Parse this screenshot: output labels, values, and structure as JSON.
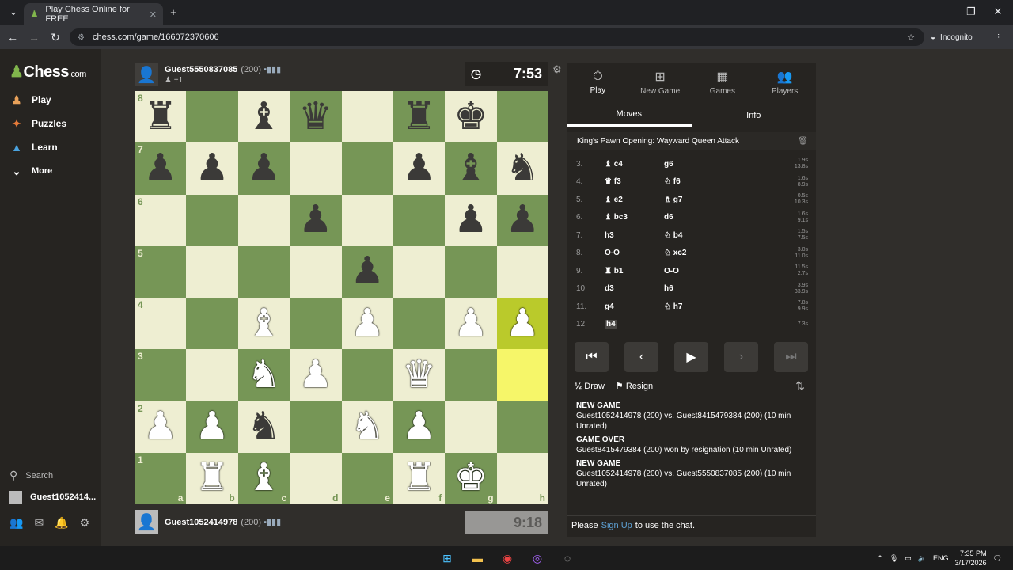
{
  "browser": {
    "tab_title": "Play Chess Online for FREE",
    "url": "chess.com/game/166072370606",
    "incognito_label": "Incognito"
  },
  "sidebar": {
    "logo": "Chess",
    "logo_suffix": ".com",
    "items": [
      {
        "label": "Play",
        "icon": "play-pawn-icon"
      },
      {
        "label": "Puzzles",
        "icon": "puzzle-icon"
      },
      {
        "label": "Learn",
        "icon": "learn-cap-icon"
      },
      {
        "label": "More",
        "icon": "chevron-down-icon"
      }
    ],
    "search_label": "Search",
    "user_label": "Guest1052414..."
  },
  "top_player": {
    "name": "Guest5550837085",
    "rating": "(200)",
    "sub": "+1",
    "clock": "7:53"
  },
  "bottom_player": {
    "name": "Guest1052414978",
    "rating": "(200)",
    "clock": "9:18"
  },
  "board": {
    "ranks": [
      "8",
      "7",
      "6",
      "5",
      "4",
      "3",
      "2",
      "1"
    ],
    "files": [
      "a",
      "b",
      "c",
      "d",
      "e",
      "f",
      "g",
      "h"
    ],
    "position": [
      [
        "br",
        "",
        "bb",
        "bq",
        "",
        "br",
        "bk",
        ""
      ],
      [
        "bp",
        "bp",
        "bp",
        "",
        "",
        "bp",
        "bb",
        "bn"
      ],
      [
        "",
        "",
        "",
        "bp",
        "",
        "",
        "bp",
        "bp"
      ],
      [
        "",
        "",
        "",
        "",
        "bp",
        "",
        "",
        ""
      ],
      [
        "",
        "",
        "wb",
        "",
        "wp",
        "",
        "wp",
        "wp"
      ],
      [
        "",
        "",
        "wn",
        "wp",
        "",
        "wq",
        "",
        ""
      ],
      [
        "wp",
        "wp",
        "bn",
        "",
        "wn",
        "wp",
        "",
        ""
      ],
      [
        "",
        "wr",
        "wb",
        "",
        "",
        "wr",
        "wk",
        ""
      ]
    ],
    "highlight": [
      "h4",
      "h3"
    ]
  },
  "panel": {
    "tabs": [
      {
        "label": "Play",
        "icon": "stopwatch-icon"
      },
      {
        "label": "New Game",
        "icon": "plus-icon"
      },
      {
        "label": "Games",
        "icon": "board-icon"
      },
      {
        "label": "Players",
        "icon": "players-icon"
      }
    ],
    "subtabs": [
      "Moves",
      "Info"
    ],
    "opening": "King's Pawn Opening: Wayward Queen Attack",
    "moves": [
      {
        "no": "3.",
        "w": "♝ c4",
        "b": "g6",
        "tw": "1.9s",
        "tb": "13.8s"
      },
      {
        "no": "4.",
        "w": "♛ f3",
        "b": "♘ f6",
        "tw": "1.6s",
        "tb": "8.9s"
      },
      {
        "no": "5.",
        "w": "♝ e2",
        "b": "♗ g7",
        "tw": "0.5s",
        "tb": "10.3s"
      },
      {
        "no": "6.",
        "w": "♝ bc3",
        "b": "d6",
        "tw": "1.6s",
        "tb": "9.1s"
      },
      {
        "no": "7.",
        "w": "h3",
        "b": "♘ b4",
        "tw": "1.5s",
        "tb": "7.5s"
      },
      {
        "no": "8.",
        "w": "O-O",
        "b": "♘ xc2",
        "tw": "3.0s",
        "tb": "11.0s"
      },
      {
        "no": "9.",
        "w": "♜ b1",
        "b": "O-O",
        "tw": "11.5s",
        "tb": "2.7s"
      },
      {
        "no": "10.",
        "w": "d3",
        "b": "h6",
        "tw": "3.9s",
        "tb": "33.9s"
      },
      {
        "no": "11.",
        "w": "g4",
        "b": "♘ h7",
        "tw": "7.8s",
        "tb": "9.9s"
      },
      {
        "no": "12.",
        "w": "h4",
        "b": "",
        "tw": "7.3s",
        "tb": ""
      }
    ],
    "draw_label": "Draw",
    "resign_label": "Resign",
    "log": [
      {
        "head": "NEW GAME",
        "text": "Guest1052414978 (200) vs. Guest8415479384 (200) (10 min Unrated)"
      },
      {
        "head": "GAME OVER",
        "text": "Guest8415479384 (200) won by resignation (10 min Unrated)"
      },
      {
        "head": "NEW GAME",
        "text": "Guest1052414978 (200) vs. Guest5550837085 (200) (10 min Unrated)"
      }
    ],
    "chat_pre": "Please",
    "chat_link": "Sign Up",
    "chat_post": "to use the chat."
  },
  "taskbar": {
    "lang": "ENG",
    "time": "7:35 PM",
    "date": "3/17/2026"
  }
}
